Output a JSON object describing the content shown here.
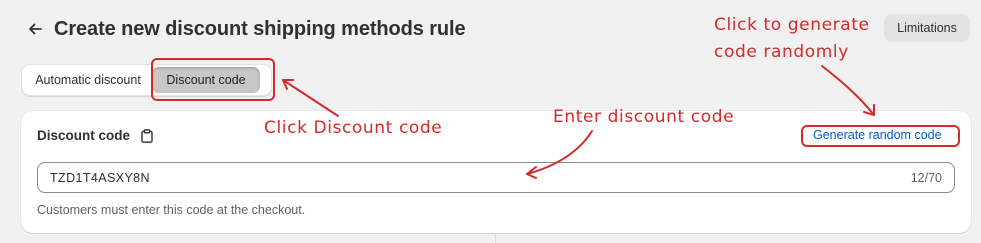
{
  "header": {
    "title": "Create new discount shipping methods rule",
    "back_icon": "arrow-left-icon",
    "limitations_label": "Limitations"
  },
  "tabs": [
    {
      "label": "Automatic discount",
      "active": false
    },
    {
      "label": "Discount code",
      "active": true
    }
  ],
  "card": {
    "label": "Discount code",
    "label_icon": "clipboard-icon",
    "generate_link": "Generate random code",
    "code_value": "TZD1T4ASXY8N",
    "char_count": "12/70",
    "help_text": "Customers must enter this code at the checkout."
  },
  "annotations": {
    "click_discount_code": "Click Discount code",
    "enter_discount_code": "Enter discount code",
    "random_line1": "Click to generate",
    "random_line2": "code randomly"
  },
  "colors": {
    "annotation": "#d42a2a",
    "link": "#005bd3",
    "background": "#f1f1f1"
  }
}
